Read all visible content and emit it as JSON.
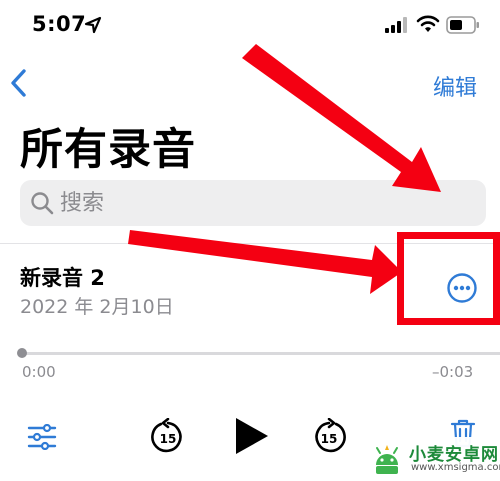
{
  "status_bar": {
    "time": "5:07"
  },
  "nav": {
    "edit_label": "编辑"
  },
  "page": {
    "title": "所有录音"
  },
  "search": {
    "placeholder": "搜索"
  },
  "recording": {
    "name": "新录音 2",
    "date": "2022 年 2月10日"
  },
  "player": {
    "elapsed": "0:00",
    "remaining": "–0:03",
    "skip_back_label": "15",
    "skip_forward_label": "15",
    "progress": 0
  },
  "watermark": {
    "name": "小麦安卓网",
    "url": "www.xmsigma.com"
  },
  "colors": {
    "accent": "#2f7bd6",
    "annotation_red": "#f40012",
    "watermark_green": "#1d8a3a"
  },
  "icons": [
    "location-arrow-icon",
    "cellular-signal-icon",
    "wifi-icon",
    "battery-icon",
    "chevron-left-icon",
    "search-icon",
    "ellipsis-circle-icon",
    "sliders-icon",
    "skip-back-15-icon",
    "play-icon",
    "skip-forward-15-icon",
    "trash-icon"
  ]
}
